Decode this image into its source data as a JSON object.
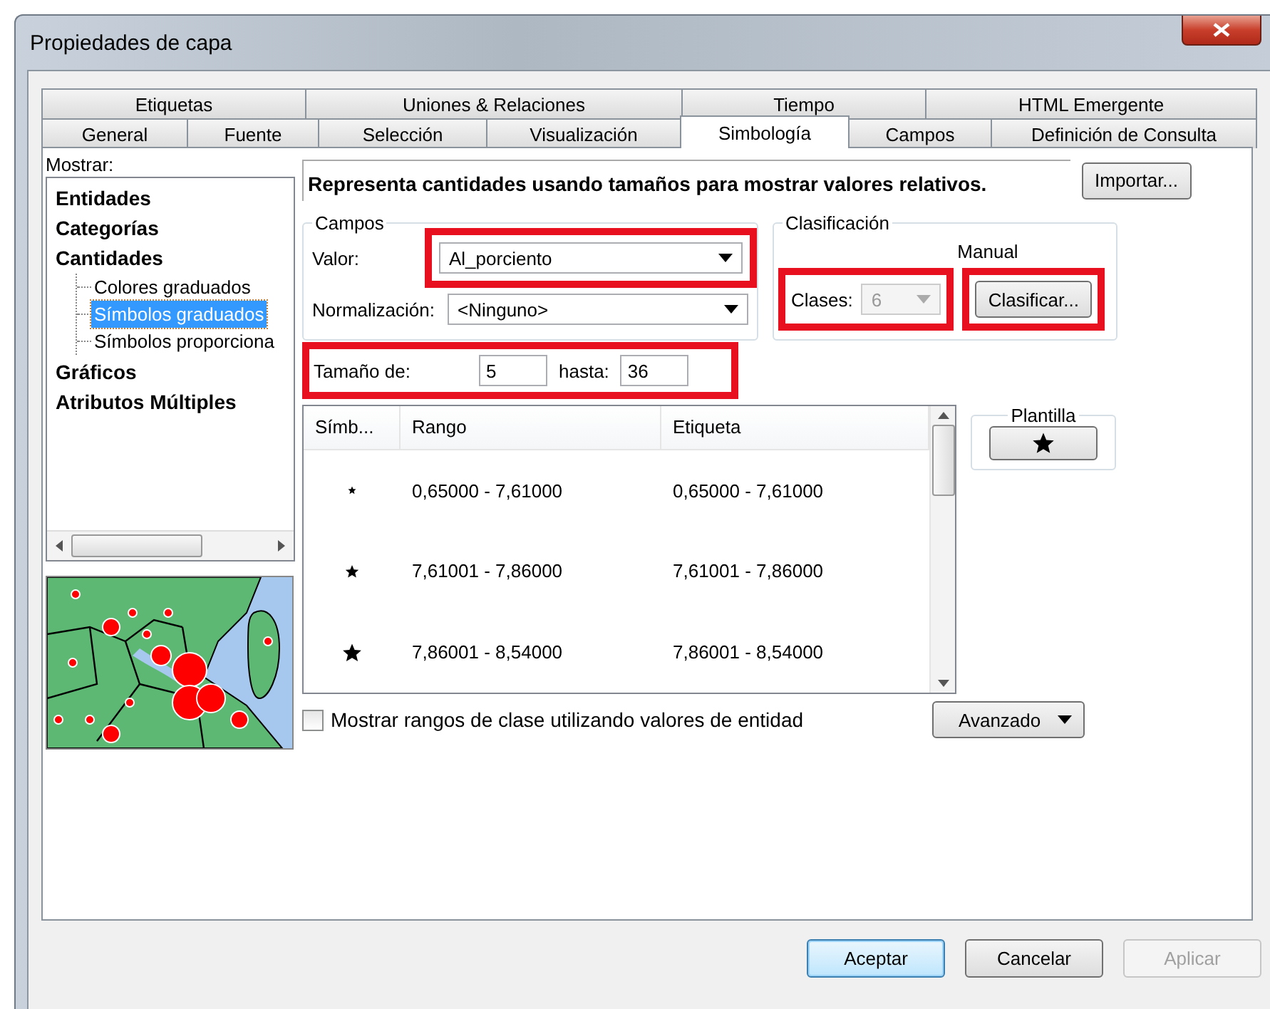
{
  "window": {
    "title": "Propiedades de capa"
  },
  "tabs": {
    "back_row": [
      {
        "label": "Etiquetas",
        "selected": false
      },
      {
        "label": "Uniones & Relaciones",
        "selected": false
      },
      {
        "label": "Tiempo",
        "selected": false
      },
      {
        "label": "HTML Emergente",
        "selected": false
      }
    ],
    "front_row": [
      {
        "label": "General",
        "selected": false
      },
      {
        "label": "Fuente",
        "selected": false
      },
      {
        "label": "Selección",
        "selected": false
      },
      {
        "label": "Visualización",
        "selected": false
      },
      {
        "label": "Simbología",
        "selected": true
      },
      {
        "label": "Campos",
        "selected": false
      },
      {
        "label": "Definición de Consulta",
        "selected": false
      }
    ]
  },
  "show_panel": {
    "label": "Mostrar:",
    "tree": [
      {
        "label": "Entidades",
        "selected": false
      },
      {
        "label": "Categorías",
        "selected": false
      },
      {
        "label": "Cantidades",
        "selected": false,
        "children": [
          {
            "label": "Colores graduados",
            "selected": false
          },
          {
            "label": "Símbolos graduados",
            "selected": true
          },
          {
            "label": "Símbolos proporciona",
            "selected": false
          }
        ]
      },
      {
        "label": "Gráficos",
        "selected": false
      },
      {
        "label": "Atributos Múltiples",
        "selected": false
      }
    ]
  },
  "description": "Representa cantidades usando tamaños para mostrar valores relativos.",
  "import_button": "Importar...",
  "fields_group": {
    "title": "Campos",
    "value": {
      "label": "Valor:",
      "value": "Al_porciento"
    },
    "normalization": {
      "label": "Normalización:",
      "value": "<Ninguno>"
    }
  },
  "classification_group": {
    "title": "Clasificación",
    "method": "Manual",
    "classes": {
      "label": "Clases:",
      "value": "6",
      "disabled": true
    },
    "classify_button": "Clasificar..."
  },
  "size": {
    "from_label": "Tamaño de:",
    "from": "5",
    "to_label": "hasta:",
    "to": "36"
  },
  "table": {
    "columns": [
      "Símb...",
      "Rango",
      "Etiqueta"
    ],
    "rows": [
      {
        "range": "0,65000 - 7,61000",
        "label": "0,65000 - 7,61000"
      },
      {
        "range": "7,61001 - 7,86000",
        "label": "7,61001 - 7,86000"
      },
      {
        "range": "7,86001 - 8,54000",
        "label": "7,86001 - 8,54000"
      }
    ]
  },
  "template": {
    "title": "Plantilla"
  },
  "show_ranges_checkbox": {
    "label": "Mostrar rangos de clase utilizando valores de entidad",
    "checked": false
  },
  "advanced_button": "Avanzado",
  "buttons": [
    {
      "label": "Aceptar",
      "default": true,
      "disabled": false
    },
    {
      "label": "Cancelar",
      "default": false,
      "disabled": false
    },
    {
      "label": "Aplicar",
      "default": false,
      "disabled": true
    }
  ]
}
